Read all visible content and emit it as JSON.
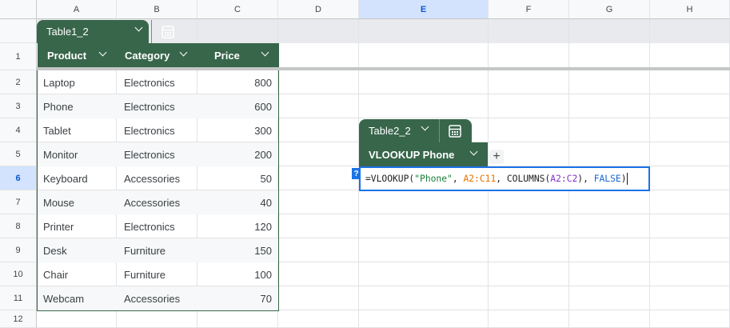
{
  "columns": [
    "A",
    "B",
    "C",
    "D",
    "E",
    "F",
    "G",
    "H"
  ],
  "selected_column": "E",
  "rows": [
    "1",
    "2",
    "3",
    "4",
    "5",
    "6",
    "7",
    "8",
    "9",
    "10",
    "11",
    "12"
  ],
  "selected_row": "6",
  "table1": {
    "name": "Table1_2",
    "headers": [
      "Product",
      "Category",
      "Price"
    ],
    "rows": [
      [
        "Laptop",
        "Electronics",
        "800"
      ],
      [
        "Phone",
        "Electronics",
        "600"
      ],
      [
        "Tablet",
        "Electronics",
        "300"
      ],
      [
        "Monitor",
        "Electronics",
        "200"
      ],
      [
        "Keyboard",
        "Accessories",
        "50"
      ],
      [
        "Mouse",
        "Accessories",
        "40"
      ],
      [
        "Printer",
        "Electronics",
        "120"
      ],
      [
        "Desk",
        "Furniture",
        "150"
      ],
      [
        "Chair",
        "Furniture",
        "100"
      ],
      [
        "Webcam",
        "Accessories",
        "70"
      ]
    ]
  },
  "table2": {
    "name": "Table2_2",
    "header": "VLOOKUP Phone"
  },
  "formula": {
    "parts": [
      {
        "text": "=VLOOKUP(",
        "color": "black"
      },
      {
        "text": "\"Phone\"",
        "color": "green"
      },
      {
        "text": ", ",
        "color": "black"
      },
      {
        "text": "A2:C11",
        "color": "orange"
      },
      {
        "text": ", COLUMNS(",
        "color": "black"
      },
      {
        "text": "A2:C2",
        "color": "purple"
      },
      {
        "text": "), ",
        "color": "black"
      },
      {
        "text": "FALSE",
        "color": "blue"
      },
      {
        "text": ")",
        "color": "black"
      }
    ]
  },
  "help_badge": "?",
  "add_column_icon": "+",
  "icons": {
    "chevron": "chevron-down-icon",
    "table_settings": "table-settings-icon",
    "add": "plus-icon"
  },
  "colors": {
    "table_green": "#38664b",
    "selection_blue": "#1a73e8",
    "header_selected": "#d3e3fd"
  }
}
